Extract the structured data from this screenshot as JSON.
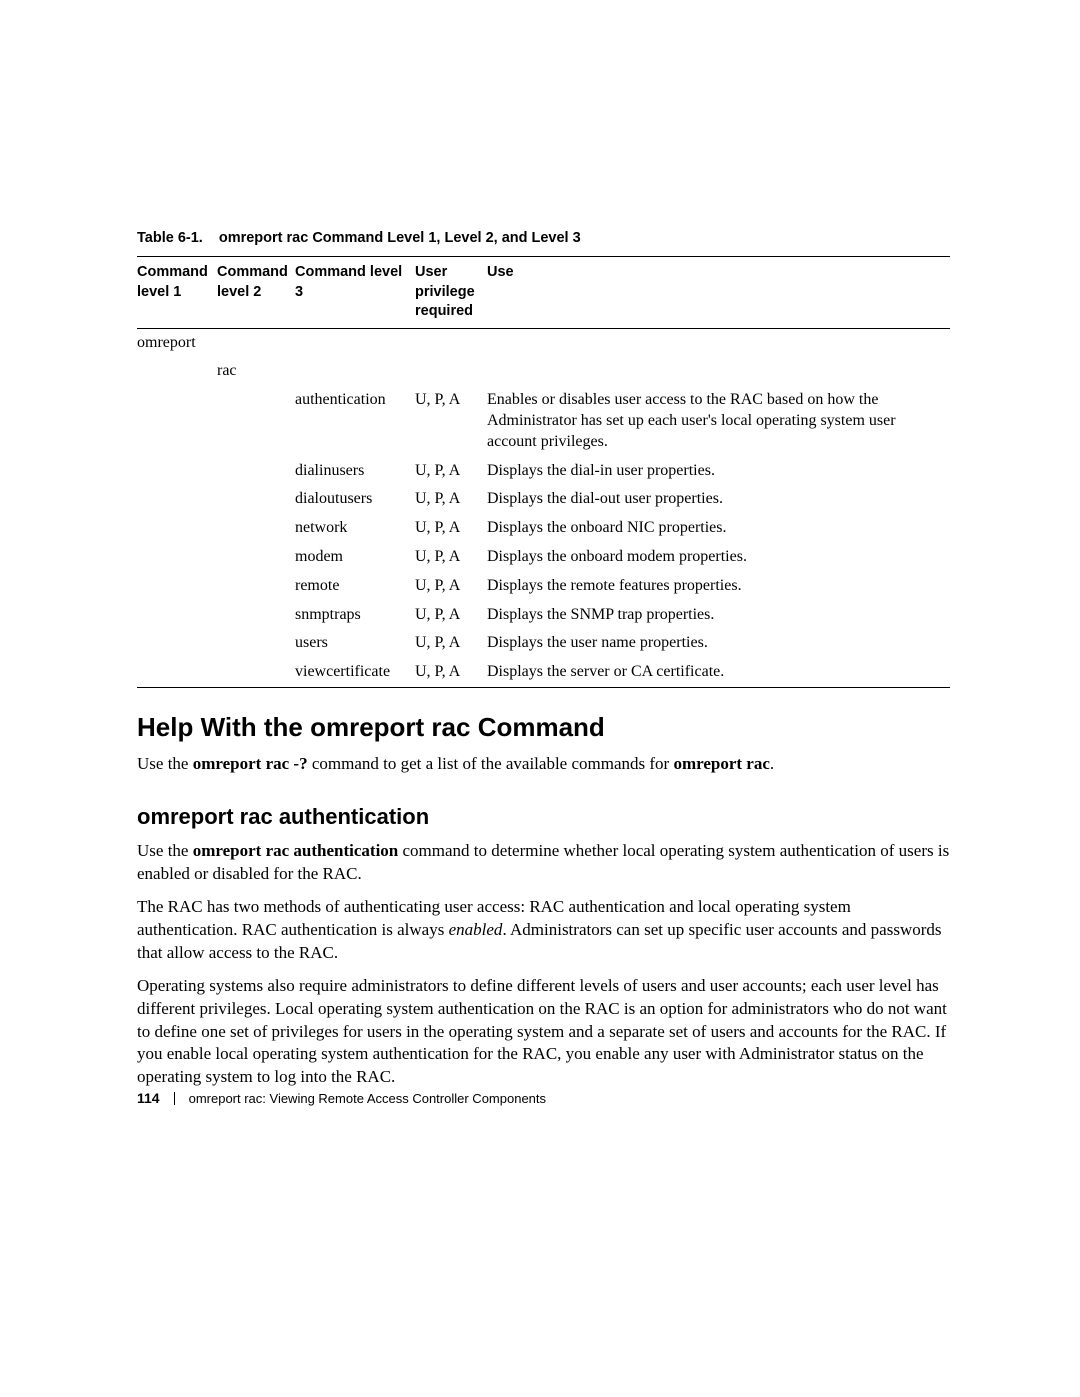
{
  "table": {
    "caption_label": "Table 6-1.",
    "caption_text": "omreport rac Command Level 1, Level 2, and Level 3",
    "headers": {
      "l1": "Command level 1",
      "l2": "Command level 2",
      "l3": "Command level 3",
      "priv": "User privilege required",
      "use": "Use"
    },
    "rows": [
      {
        "l1": "omreport",
        "l2": "",
        "l3": "",
        "priv": "",
        "use": ""
      },
      {
        "l1": "",
        "l2": "rac",
        "l3": "",
        "priv": "",
        "use": ""
      },
      {
        "l1": "",
        "l2": "",
        "l3": "authentication",
        "priv": "U, P, A",
        "use": "Enables or disables user access to the RAC based on how the Administrator has set up each user's local operating system user account privileges."
      },
      {
        "l1": "",
        "l2": "",
        "l3": "dialinusers",
        "priv": "U, P, A",
        "use": "Displays the dial-in user properties."
      },
      {
        "l1": "",
        "l2": "",
        "l3": "dialoutusers",
        "priv": "U, P, A",
        "use": "Displays the dial-out user properties."
      },
      {
        "l1": "",
        "l2": "",
        "l3": "network",
        "priv": "U, P, A",
        "use": "Displays the onboard NIC properties."
      },
      {
        "l1": "",
        "l2": "",
        "l3": "modem",
        "priv": "U, P, A",
        "use": "Displays the onboard modem properties."
      },
      {
        "l1": "",
        "l2": "",
        "l3": "remote",
        "priv": "U, P, A",
        "use": "Displays the remote features properties."
      },
      {
        "l1": "",
        "l2": "",
        "l3": "snmptraps",
        "priv": "U, P, A",
        "use": "Displays the SNMP trap properties."
      },
      {
        "l1": "",
        "l2": "",
        "l3": "users",
        "priv": "U, P, A",
        "use": "Displays the user name properties."
      },
      {
        "l1": "",
        "l2": "",
        "l3": "viewcertificate",
        "priv": "U, P, A",
        "use": "Displays the server or CA certificate."
      }
    ]
  },
  "sections": {
    "help_heading": "Help With the omreport rac Command",
    "help_para_parts": {
      "p1a": "Use the ",
      "p1b": "omreport rac -?",
      "p1c": " command to get a list of the available commands for ",
      "p1d": "omreport rac",
      "p1e": "."
    },
    "auth_heading": "omreport rac authentication",
    "auth_p1": {
      "a": "Use the ",
      "b": "omreport rac authentication",
      "c": " command to determine whether local operating system authentication of users is enabled or disabled for the RAC."
    },
    "auth_p2": {
      "a": "The RAC has two methods of authenticating user access: RAC authentication and local operating system authentication. RAC authentication is always ",
      "b": "enabled",
      "c": ". Administrators can set up specific user accounts and passwords that allow access to the RAC."
    },
    "auth_p3": "Operating systems also require administrators to define different levels of users and user accounts; each user level has different privileges. Local operating system authentication on the RAC is an option for administrators who do not want to define one set of privileges for users in the operating system and a separate set of users and accounts for the RAC. If you enable local operating system authentication for the RAC, you enable any user with Administrator status on the operating system to log into the RAC."
  },
  "footer": {
    "page_num": "114",
    "chapter": "omreport rac: Viewing Remote Access Controller Components"
  }
}
